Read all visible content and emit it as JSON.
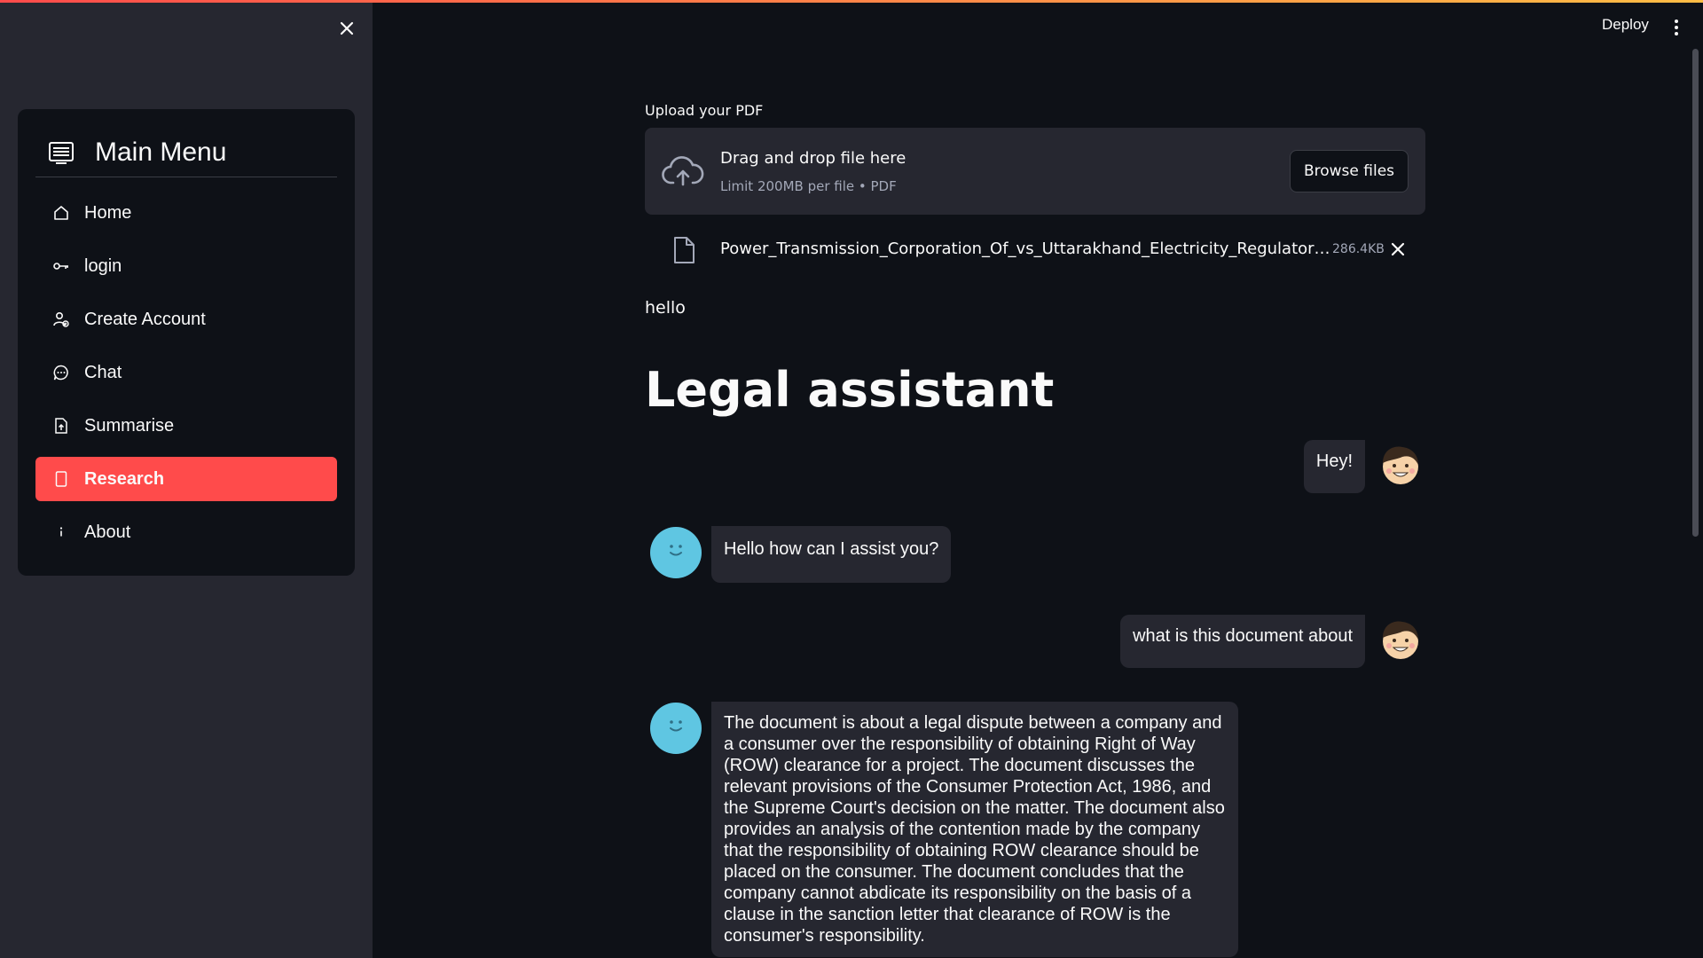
{
  "sidebar": {
    "close_label": "Close sidebar",
    "menu": {
      "title": "Main Menu",
      "items": [
        {
          "label": "Home",
          "icon": "house-icon",
          "active": false
        },
        {
          "label": "login",
          "icon": "key-icon",
          "active": false
        },
        {
          "label": "Create Account",
          "icon": "person-add-icon",
          "active": false
        },
        {
          "label": "Chat",
          "icon": "chat-dots-icon",
          "active": false
        },
        {
          "label": "Summarise",
          "icon": "file-arrow-up-icon",
          "active": false
        },
        {
          "label": "Research",
          "icon": "file-icon",
          "active": true
        },
        {
          "label": "About",
          "icon": "info-icon",
          "active": false
        }
      ]
    }
  },
  "topbar": {
    "deploy_label": "Deploy",
    "menu_icon": "kebab-menu-icon"
  },
  "main": {
    "upload": {
      "label": "Upload your PDF",
      "drop_title": "Drag and drop file here",
      "drop_subtitle": "Limit 200MB per file • PDF",
      "browse_label": "Browse files"
    },
    "file": {
      "name": "Power_Transmission_Corporation_Of_vs_Uttarakhand_Electricity_Regulatory_Commission.pdf",
      "size": "286.4KB"
    },
    "hello_text": "hello",
    "title": "Legal assistant",
    "messages": [
      {
        "role": "user",
        "text": "Hey!"
      },
      {
        "role": "assistant",
        "text": "Hello how can I assist you?"
      },
      {
        "role": "user",
        "text": "what is this document about"
      },
      {
        "role": "assistant",
        "text": "The document is about a legal dispute between a company and a consumer over the responsibility of obtaining Right of Way (ROW) clearance for a project. The document discusses the relevant provisions of the Consumer Protection Act, 1986, and the Supreme Court's decision on the matter. The document also provides an analysis of the contention made by the company that the responsibility of obtaining ROW clearance should be placed on the consumer. The document concludes that the company cannot abdicate its responsibility on the basis of a clause in the sanction letter that clearance of ROW is the consumer's responsibility."
      }
    ]
  },
  "colors": {
    "accent": "#ff4b4b",
    "app_bg": "#0e1117",
    "sidebar_bg": "#262730",
    "bot_avatar": "#5fc6e2"
  }
}
